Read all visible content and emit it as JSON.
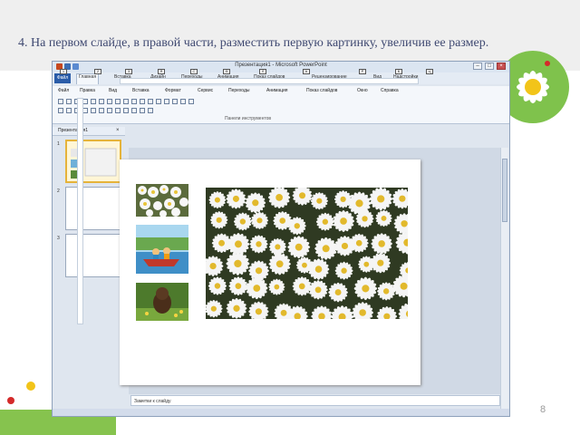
{
  "slide": {
    "title": "4. На первом слайде, в правой части, разместить первую картинку, увеличив ее размер.",
    "page_number": "8"
  },
  "app": {
    "window_title": "Презентация1 - Microsoft PowerPoint",
    "file_tab": "Файл",
    "tabs": [
      "Файл",
      "Главная",
      "Вставка",
      "Дизайн",
      "Переходы",
      "Анимация",
      "Показ слайдов",
      "Рецензирование",
      "Вид",
      "Надстройки"
    ],
    "key_tips": [
      "1",
      "2",
      "3",
      "Я",
      "С",
      "Ф",
      "Л",
      "А",
      "Р",
      "Б",
      "Ц",
      "О",
      "Х"
    ],
    "menu": [
      "Файл",
      "Правка",
      "Вид",
      "Вставка",
      "Формат",
      "Сервис",
      "Переходы",
      "Анимация",
      "Показ слайдов",
      "Окно",
      "Справка"
    ],
    "toolbar_group_label": "Панели инструментов",
    "pane_tab": "Презентация1",
    "pane_close": "×",
    "notes_placeholder": "Заметки к слайду",
    "thumbnail_numbers": [
      "1",
      "2",
      "3"
    ],
    "win_controls": [
      "–",
      "□",
      "×"
    ]
  },
  "colors": {
    "title_text": "#404a72",
    "accent_blue": "#2a5ca8",
    "selection_border": "#e5b33a"
  }
}
